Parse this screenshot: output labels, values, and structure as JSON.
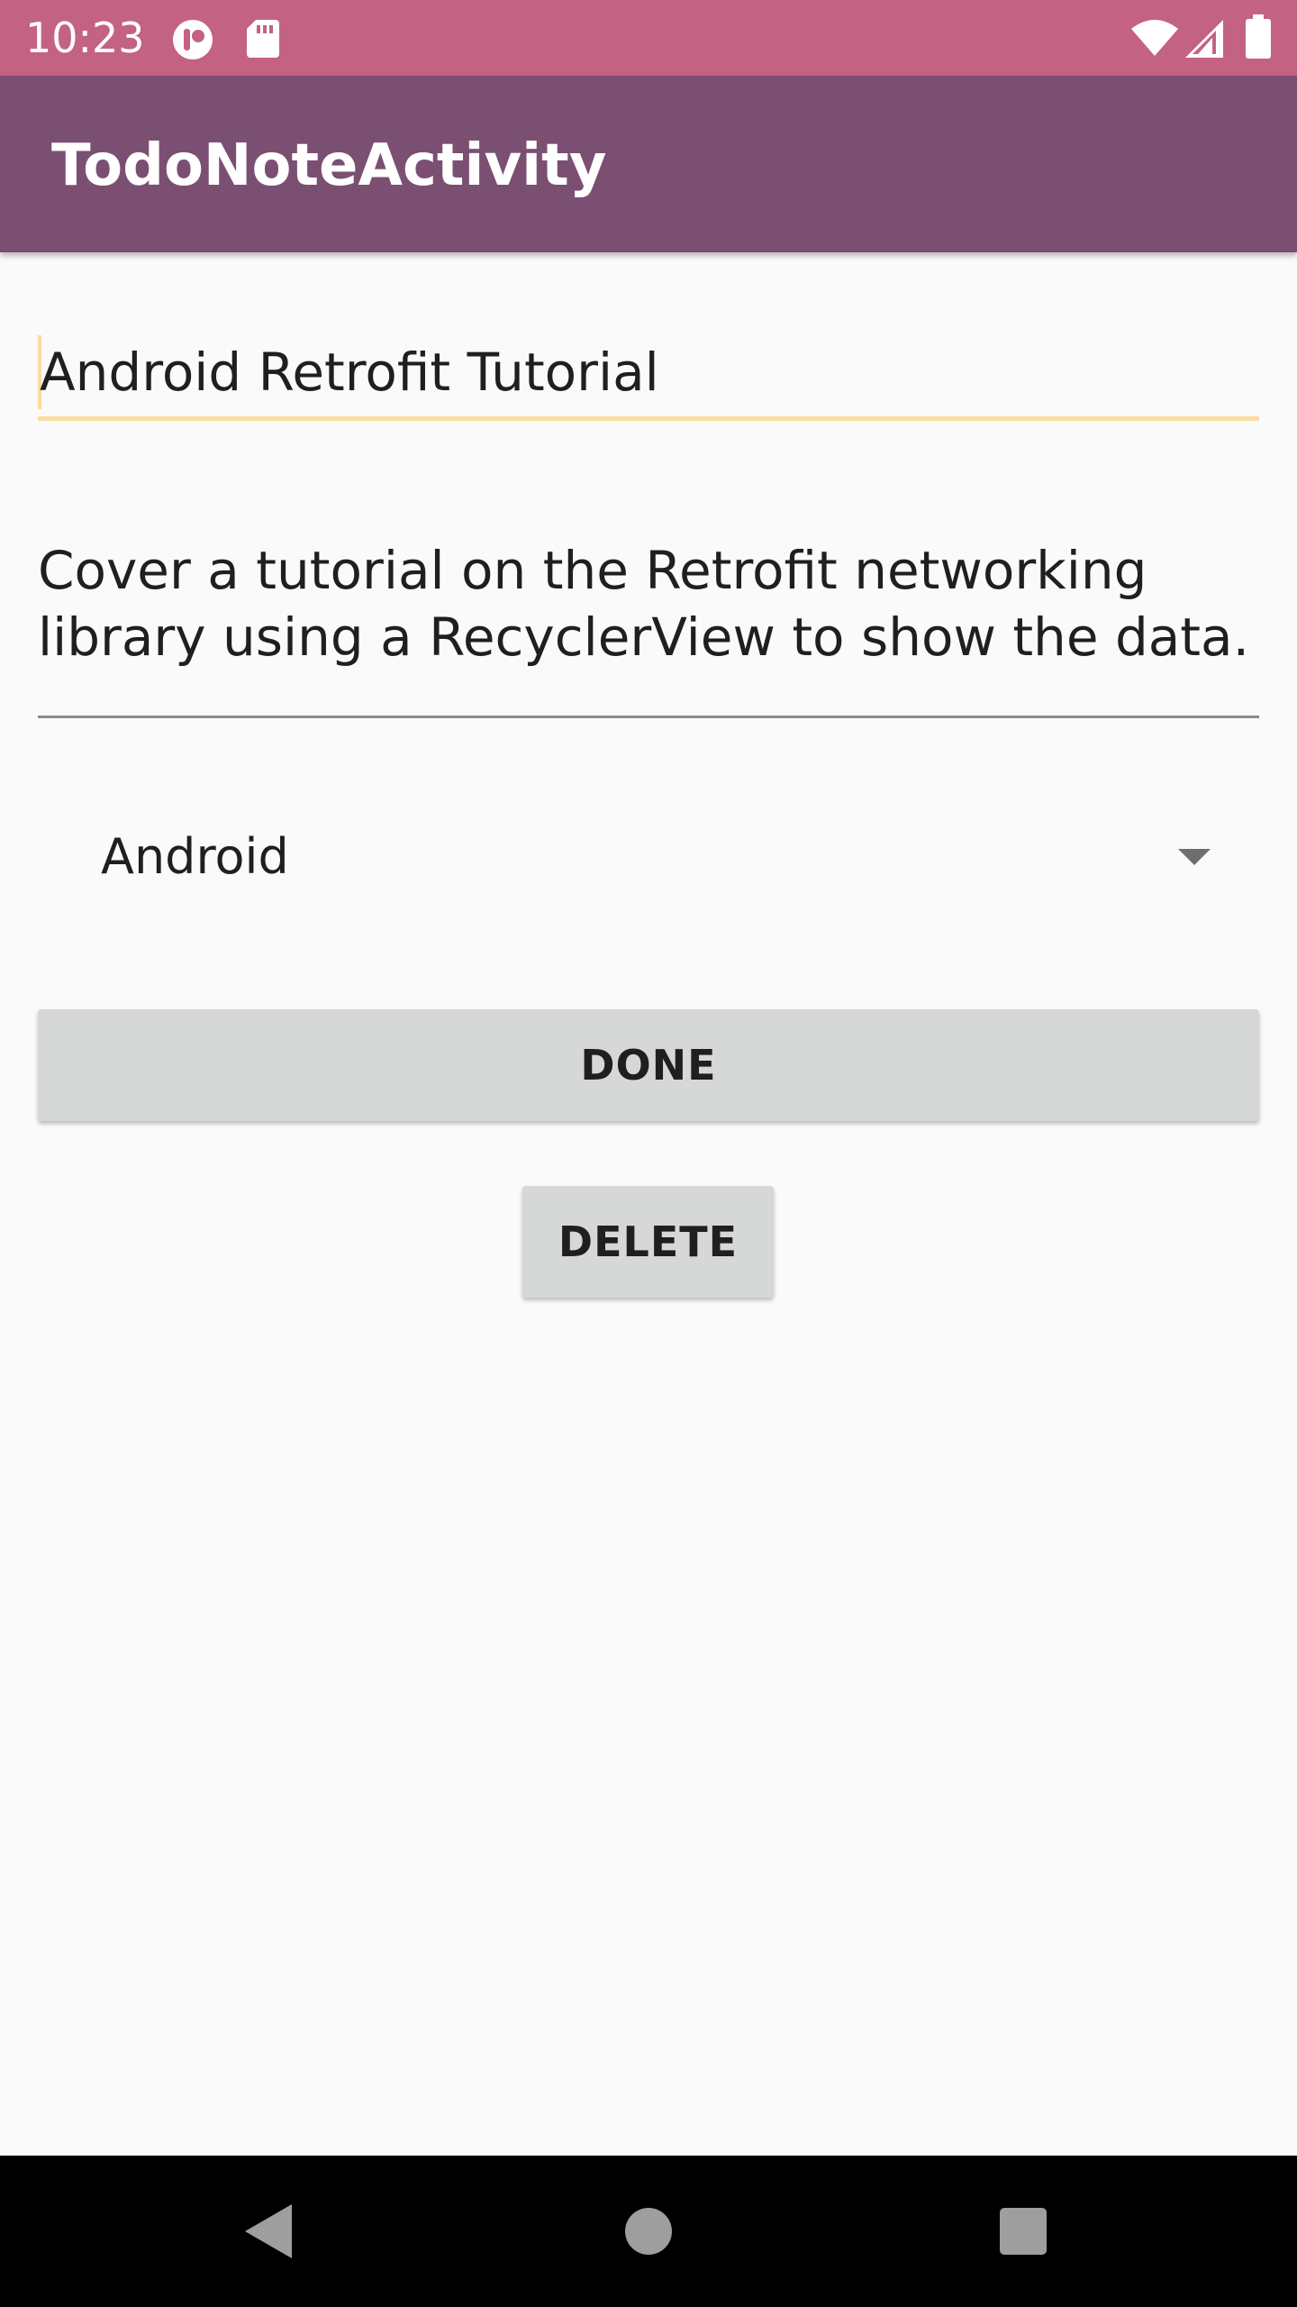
{
  "status_bar": {
    "time": "10:23",
    "background_color": "#c46283",
    "left_icons": [
      "notification-app-icon",
      "sd-card-icon"
    ],
    "right_icons": [
      "wifi-icon",
      "cellular-signal-icon",
      "battery-icon"
    ]
  },
  "app_bar": {
    "title": "TodoNoteActivity",
    "background_color": "#7b4f72"
  },
  "form": {
    "title_value": "Android Retrofit Tutorial",
    "description_value": "Cover a tutorial on the Retrofit networking library using a RecyclerView to show the data.",
    "category_selected": "Android",
    "accent_color": "#fbdba1"
  },
  "buttons": {
    "done_label": "DONE",
    "delete_label": "DELETE"
  },
  "nav_bar": {
    "icons": [
      "back-icon",
      "home-icon",
      "recents-icon"
    ]
  }
}
